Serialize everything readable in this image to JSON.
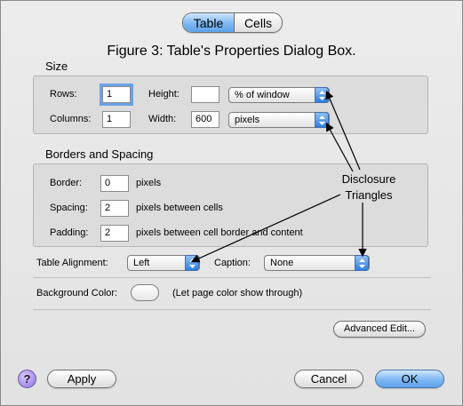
{
  "tabs": [
    {
      "label": "Table",
      "active": true
    },
    {
      "label": "Cells",
      "active": false
    }
  ],
  "figure_title": "Figure 3: Table's Properties Dialog Box.",
  "size": {
    "title": "Size",
    "rows_label": "Rows:",
    "rows_value": "1",
    "columns_label": "Columns:",
    "columns_value": "1",
    "height_label": "Height:",
    "height_value": "",
    "height_unit": "% of window",
    "width_label": "Width:",
    "width_value": "600",
    "width_unit": "pixels"
  },
  "borders": {
    "title": "Borders and Spacing",
    "border_label": "Border:",
    "border_value": "0",
    "border_unit": "pixels",
    "spacing_label": "Spacing:",
    "spacing_value": "2",
    "spacing_unit": "pixels between cells",
    "padding_label": "Padding:",
    "padding_value": "2",
    "padding_unit": "pixels between cell border and content"
  },
  "alignment": {
    "label": "Table Alignment:",
    "value": "Left",
    "caption_label": "Caption:",
    "caption_value": "None"
  },
  "background": {
    "label": "Background Color:",
    "note": "(Let page color show through)"
  },
  "annotation": {
    "line1": "Disclosure",
    "line2": "Triangles"
  },
  "buttons": {
    "advanced": "Advanced Edit...",
    "help": "?",
    "apply": "Apply",
    "cancel": "Cancel",
    "ok": "OK"
  },
  "colors": {
    "accent": "#5ea3ea",
    "window_bg": "#e6e6e6",
    "help_purple": "#8d6fe0"
  }
}
